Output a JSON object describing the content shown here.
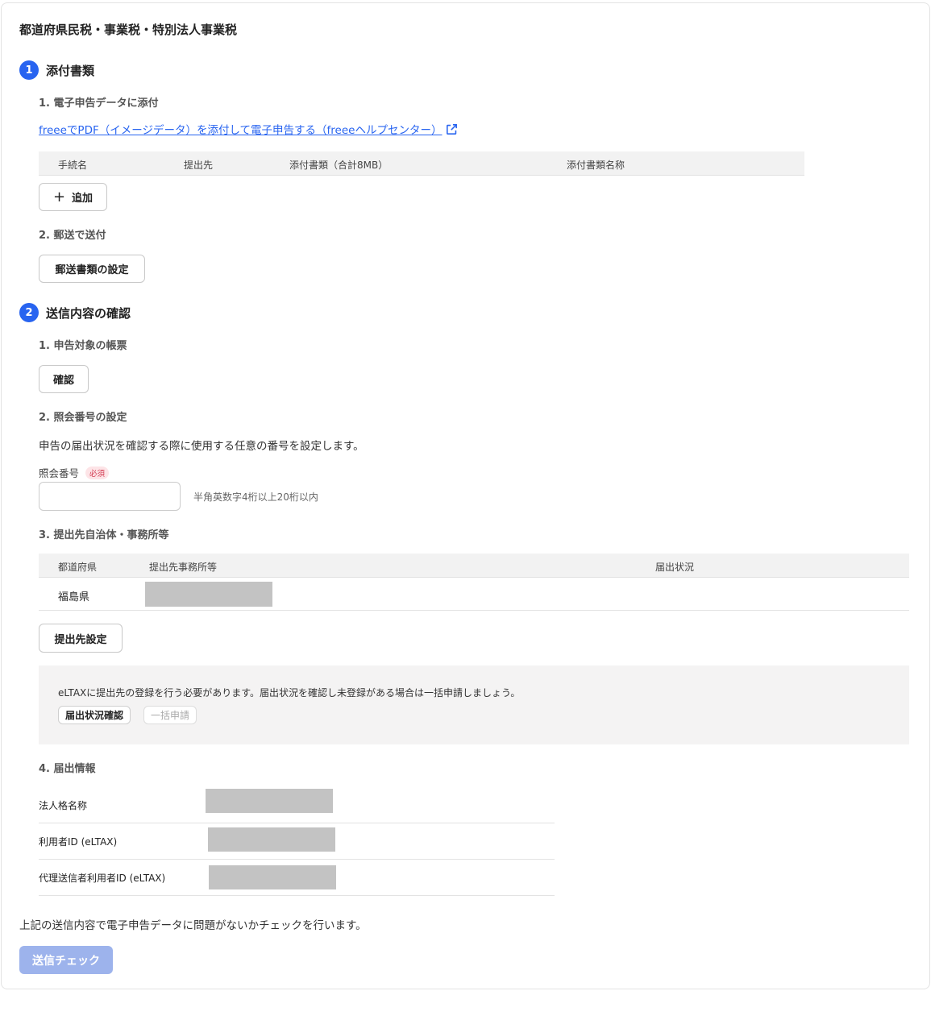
{
  "page_title": "都道府県民税・事業税・特別法人事業税",
  "step1": {
    "number": "1",
    "title": "添付書類",
    "sub1": "1. 電子申告データに添付",
    "help_link": "freeeでPDF（イメージデータ）を添付して電子申告する（freeeヘルプセンター）",
    "table_headers": [
      "手続名",
      "提出先",
      "添付書類（合計8MB）",
      "添付書類名称"
    ],
    "add_button": "追加",
    "sub2": "2. 郵送で送付",
    "mail_button": "郵送書類の設定"
  },
  "step2": {
    "number": "2",
    "title": "送信内容の確認",
    "sub1": "1. 申告対象の帳票",
    "confirm_button": "確認",
    "sub2": "2. 照会番号の設定",
    "description": "申告の届出状況を確認する際に使用する任意の番号を設定します。",
    "field_label": "照会番号",
    "required_badge": "必須",
    "field_value": "",
    "field_hint": "半角英数字4桁以上20桁以内",
    "sub3": "3. 提出先自治体・事務所等",
    "office_headers": [
      "都道府県",
      "提出先事務所等",
      "届出状況"
    ],
    "office_rows": [
      {
        "prefecture": "福島県"
      }
    ],
    "office_button": "提出先設定",
    "notice_text": "eLTAXに提出先の登録を行う必要があります。届出状況を確認し未登録がある場合は一括申請しましょう。",
    "status_check_button": "届出状況確認",
    "bulk_apply_button": "一括申請",
    "sub4": "4. 届出情報",
    "info_labels": [
      "法人格名称",
      "利用者ID (eLTAX)",
      "代理送信者利用者ID (eLTAX)"
    ]
  },
  "footer": {
    "text": "上記の送信内容で電子申告データに問題がないかチェックを行います。",
    "submit_button": "送信チェック"
  },
  "colors": {
    "accent": "#2864f0",
    "disabled_primary": "#9db3ec"
  },
  "icons": {
    "external_link": "external-link-icon",
    "add": "plus-icon"
  }
}
